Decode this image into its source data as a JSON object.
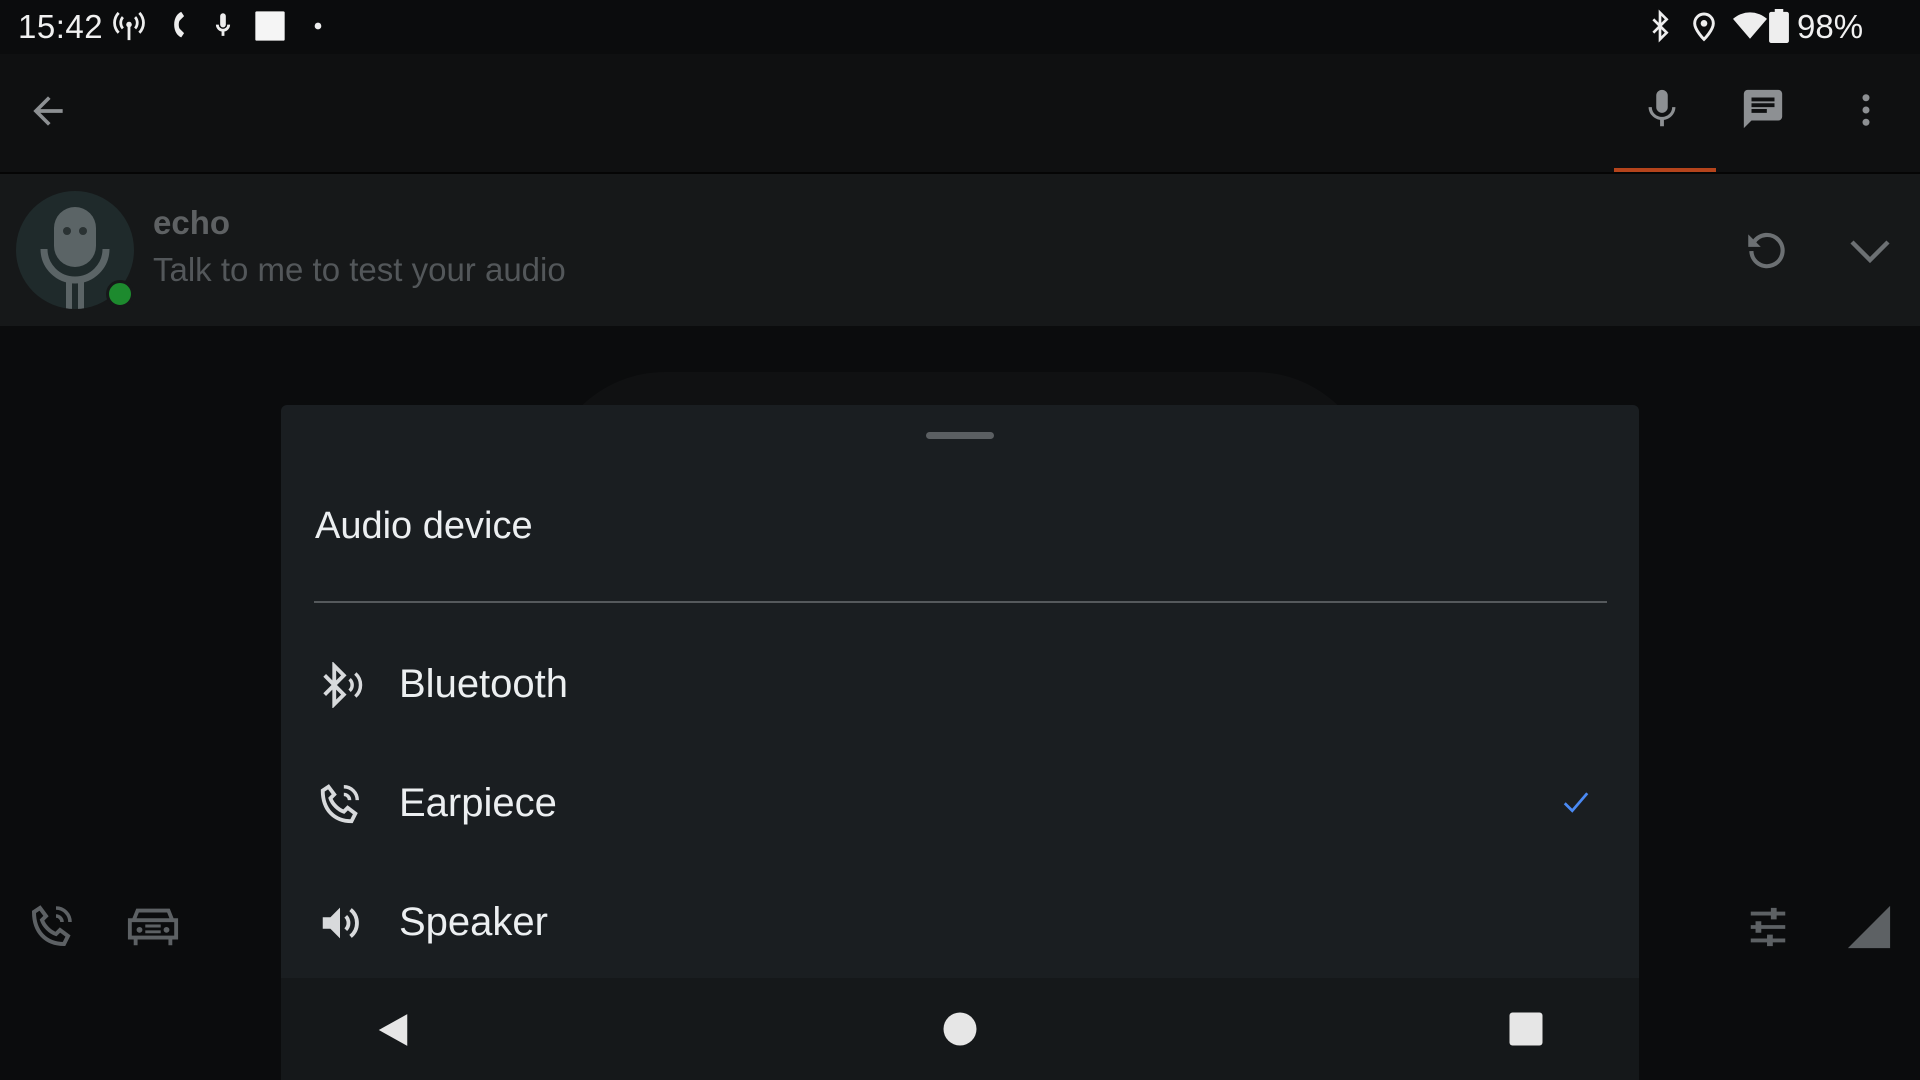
{
  "status_bar": {
    "time": "15:42",
    "left_icons": [
      "signal-tower-icon",
      "phone-handset-icon",
      "mic-notification-icon",
      "square-notification-icon",
      "dot-icon"
    ],
    "right_icons": [
      "bluetooth-icon",
      "location-icon",
      "wifi-icon",
      "battery-icon"
    ],
    "battery_percent": "98%"
  },
  "top_bar": {
    "back_icon": "arrow-back-icon",
    "actions": [
      "microphone-icon",
      "chat-icon",
      "more-vert-icon"
    ],
    "active_tab": "microphone",
    "accent_color": "#b5441c"
  },
  "echo": {
    "name": "echo",
    "status_text": "Talk to me to test your audio",
    "online_color": "#1d8a2e",
    "actions": [
      "refresh-icon",
      "chevron-down-icon"
    ]
  },
  "background_controls": [
    "phone-call-icon",
    "car-icon",
    "sliders-icon",
    "signal-triangle-icon"
  ],
  "sheet": {
    "title": "Audio device",
    "options": [
      {
        "label": "Bluetooth",
        "icon": "bluetooth-audio-icon",
        "selected": false
      },
      {
        "label": "Earpiece",
        "icon": "phone-in-talk-icon",
        "selected": true
      },
      {
        "label": "Speaker",
        "icon": "volume-up-icon",
        "selected": false
      }
    ],
    "check_color": "#4a8af4"
  },
  "nav_bar": [
    "back-triangle-icon",
    "home-circle-icon",
    "recents-square-icon"
  ]
}
